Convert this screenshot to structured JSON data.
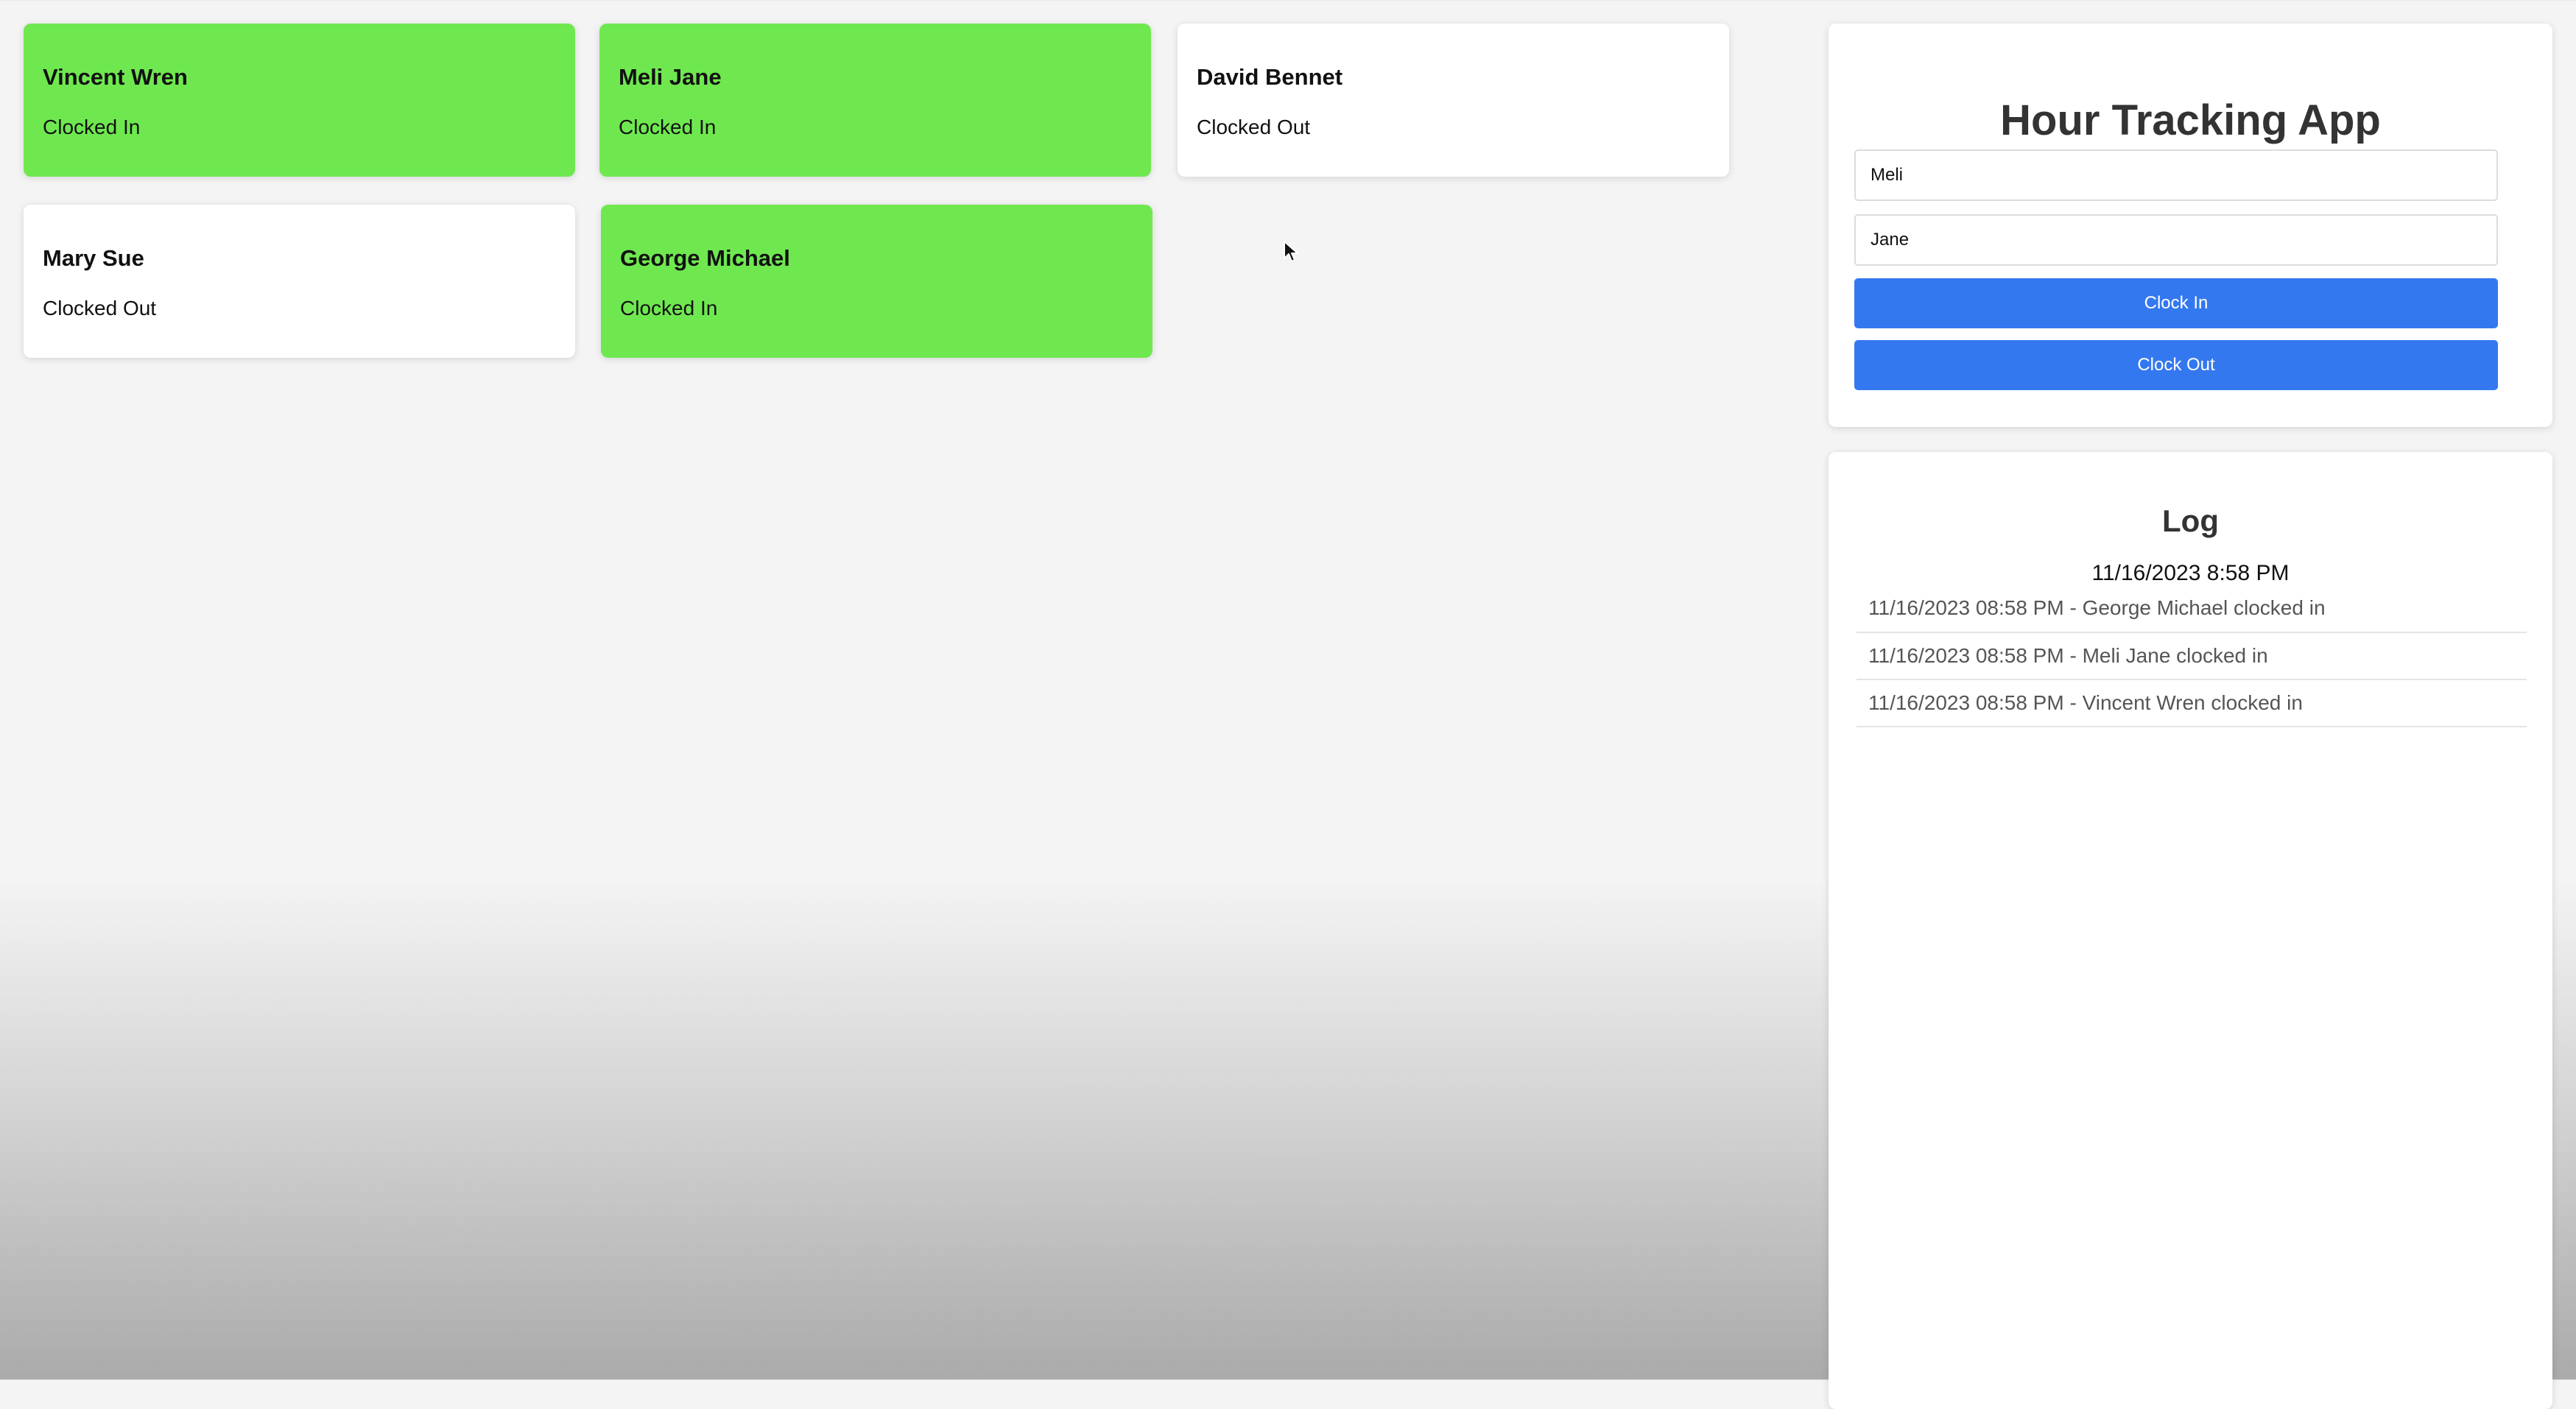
{
  "employees": [
    {
      "name": "Vincent Wren",
      "status": "Clocked In",
      "clocked_in": true
    },
    {
      "name": "Meli Jane",
      "status": "Clocked In",
      "clocked_in": true
    },
    {
      "name": "David Bennet",
      "status": "Clocked Out",
      "clocked_in": false
    },
    {
      "name": "Mary Sue",
      "status": "Clocked Out",
      "clocked_in": false
    },
    {
      "name": "George Michael",
      "status": "Clocked In",
      "clocked_in": true
    }
  ],
  "form": {
    "title": "Hour Tracking App",
    "first_name_value": "Meli",
    "last_name_value": "Jane",
    "clock_in_label": "Clock In",
    "clock_out_label": "Clock Out"
  },
  "log": {
    "title": "Log",
    "current_time": "11/16/2023 8:58 PM",
    "entries": [
      "11/16/2023 08:58 PM - George Michael clocked in",
      "11/16/2023 08:58 PM - Meli Jane clocked in",
      "11/16/2023 08:58 PM - Vincent Wren clocked in"
    ]
  },
  "colors": {
    "clocked_in": "#6fe850",
    "clocked_out": "#ffffff",
    "button": "#3478f0"
  },
  "icons": {
    "cursor": "mouse-pointer-icon"
  }
}
